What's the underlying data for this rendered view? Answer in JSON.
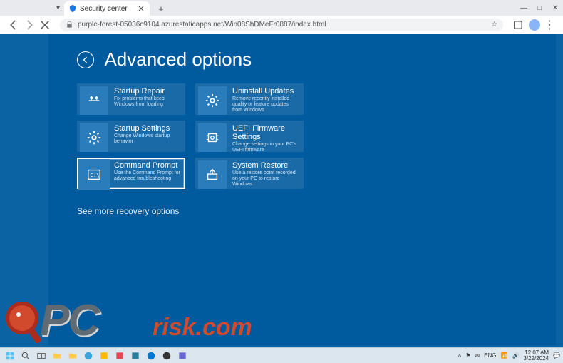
{
  "browser": {
    "tab_title": "Security center",
    "url": "purple-forest-05036c9104.azurestaticapps.net/Win08ShDMeFr0887/index.html",
    "window_controls": {
      "min": "—",
      "max": "□",
      "close": "✕"
    },
    "new_tab": "+"
  },
  "page": {
    "title": "Advanced options",
    "more": "See more recovery options",
    "tiles": {
      "left": [
        {
          "id": "startup-repair",
          "title": "Startup Repair",
          "desc": "Fix problems that keep Windows from loading",
          "selected": false
        },
        {
          "id": "startup-settings",
          "title": "Startup Settings",
          "desc": "Change Windows startup behavior",
          "selected": false
        },
        {
          "id": "command-prompt",
          "title": "Command Prompt",
          "desc": "Use the Command Prompt for advanced troubleshooting",
          "selected": true
        }
      ],
      "right": [
        {
          "id": "uninstall-updates",
          "title": "Uninstall Updates",
          "desc": "Remove recently installed quality or feature updates from Windows",
          "selected": false
        },
        {
          "id": "uefi-firmware",
          "title": "UEFI Firmware Settings",
          "desc": "Change settings in your PC's UEFI firmware",
          "selected": false
        },
        {
          "id": "system-restore",
          "title": "System Restore",
          "desc": "Use a restore point recorded on your PC to restore Windows",
          "selected": false
        }
      ]
    }
  },
  "taskbar": {
    "lang": "ENG",
    "time": "12:07 AM",
    "date": "3/22/2024"
  },
  "watermark": {
    "pc": "PC",
    "risk": "risk.com"
  }
}
